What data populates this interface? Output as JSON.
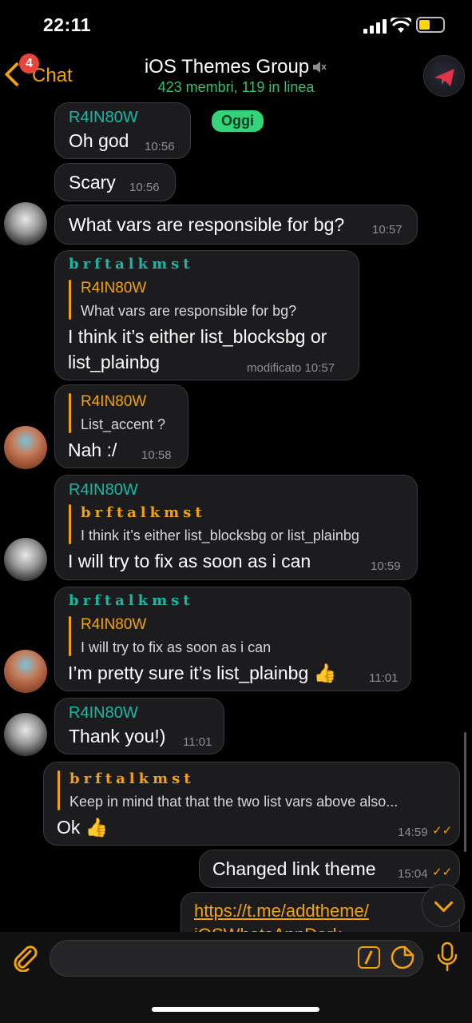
{
  "status": {
    "time": "22:11"
  },
  "header": {
    "back_label": "Chat",
    "back_badge": "4",
    "title": "iOS Themes Group",
    "subtitle": "423 membri, 119 in linea"
  },
  "date_pill": "Oggi",
  "messages": [
    {
      "sender": "R4IN80W",
      "text": "Oh god",
      "time": "10:56"
    },
    {
      "text": "Scary",
      "time": "10:56"
    },
    {
      "text": "What vars are responsible for bg?",
      "time": "10:57"
    },
    {
      "sender": "brftalkmst",
      "reply_name": "R4IN80W",
      "reply_text": "What vars are responsible for bg?",
      "text_line1": "I think it’s either list_blocksbg or",
      "text_line2": "list_plainbg",
      "time": "modificato 10:57"
    },
    {
      "reply_name": "R4IN80W",
      "reply_text": "List_accent ?",
      "text": "Nah :/",
      "time": "10:58"
    },
    {
      "sender": "R4IN80W",
      "reply_name": "brftalkmst",
      "reply_text": "I think it’s either list_blocksbg or list_plainbg",
      "text": "I will try to fix as soon as i can",
      "time": "10:59"
    },
    {
      "sender": "brftalkmst",
      "reply_name": "R4IN80W",
      "reply_text": "I will try to fix as soon as i can",
      "text": "I’m pretty sure it’s list_plainbg 👍",
      "time": "11:01"
    },
    {
      "sender": "R4IN80W",
      "text": "Thank you!)",
      "time": "11:01"
    },
    {
      "reply_name": "brftalkmst",
      "reply_text": "Keep in mind that that the two list vars above also...",
      "text": "Ok 👍",
      "time": "14:59"
    },
    {
      "text": "Changed link theme",
      "time": "15:04"
    },
    {
      "link_line1": "https://t.me/addtheme/",
      "link_line2": "iOSWhatsAppDark"
    }
  ],
  "colors": {
    "accent": "#f2a20c",
    "teal": "#19b7a3",
    "online": "#35c26a",
    "badge": "#e8443a"
  }
}
